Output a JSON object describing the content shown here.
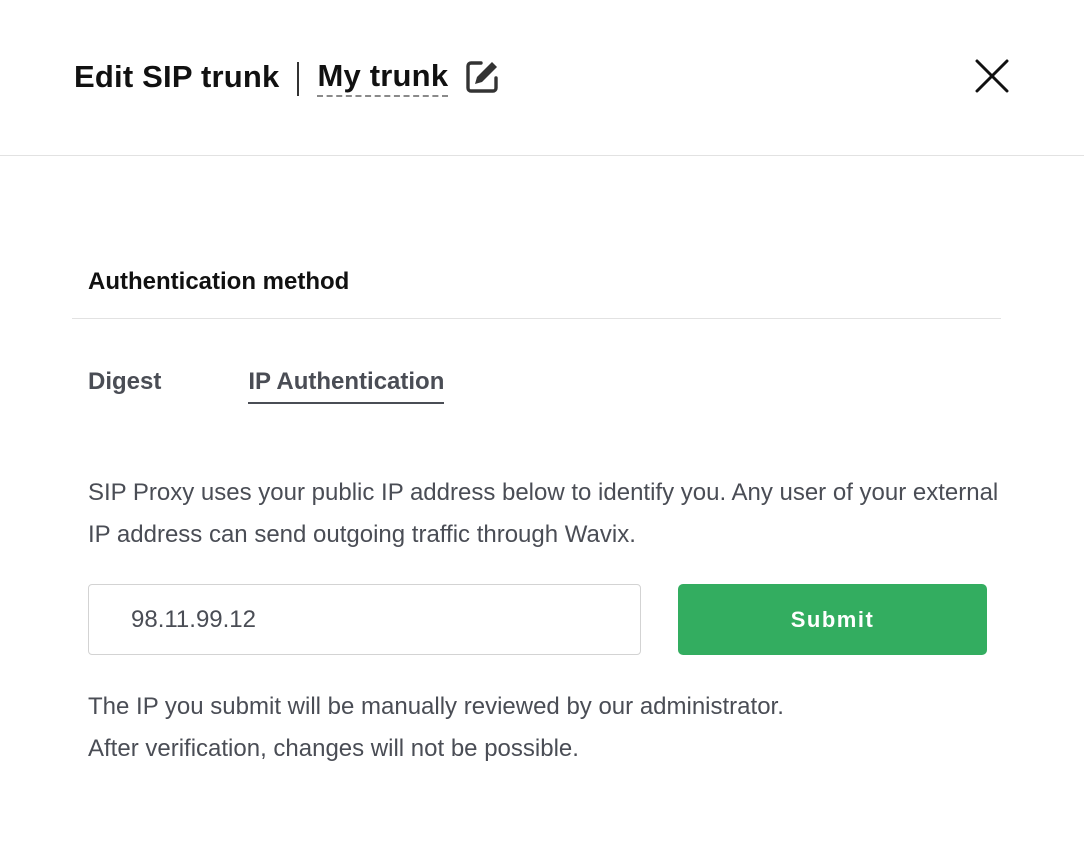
{
  "header": {
    "title": "Edit SIP trunk",
    "trunk_name": "My trunk",
    "edit_icon": "pencil-square-icon",
    "close_icon": "close-x-icon"
  },
  "auth": {
    "section_title": "Authentication method",
    "tabs": [
      {
        "label": "Digest",
        "active": false
      },
      {
        "label": "IP Authentication",
        "active": true
      }
    ],
    "description": "SIP Proxy uses your public IP address below to identify you. Any user of your external IP address can send outgoing traffic through Wavix.",
    "ip_value": "98.11.99.12",
    "submit_label": "Submit",
    "note_line1": "The IP you submit will be manually reviewed by our administrator.",
    "note_line2": "After verification, changes will not be possible."
  },
  "colors": {
    "accent_green": "#33ad60",
    "text_gray": "#4a4d55",
    "divider": "#e2e2e2"
  }
}
